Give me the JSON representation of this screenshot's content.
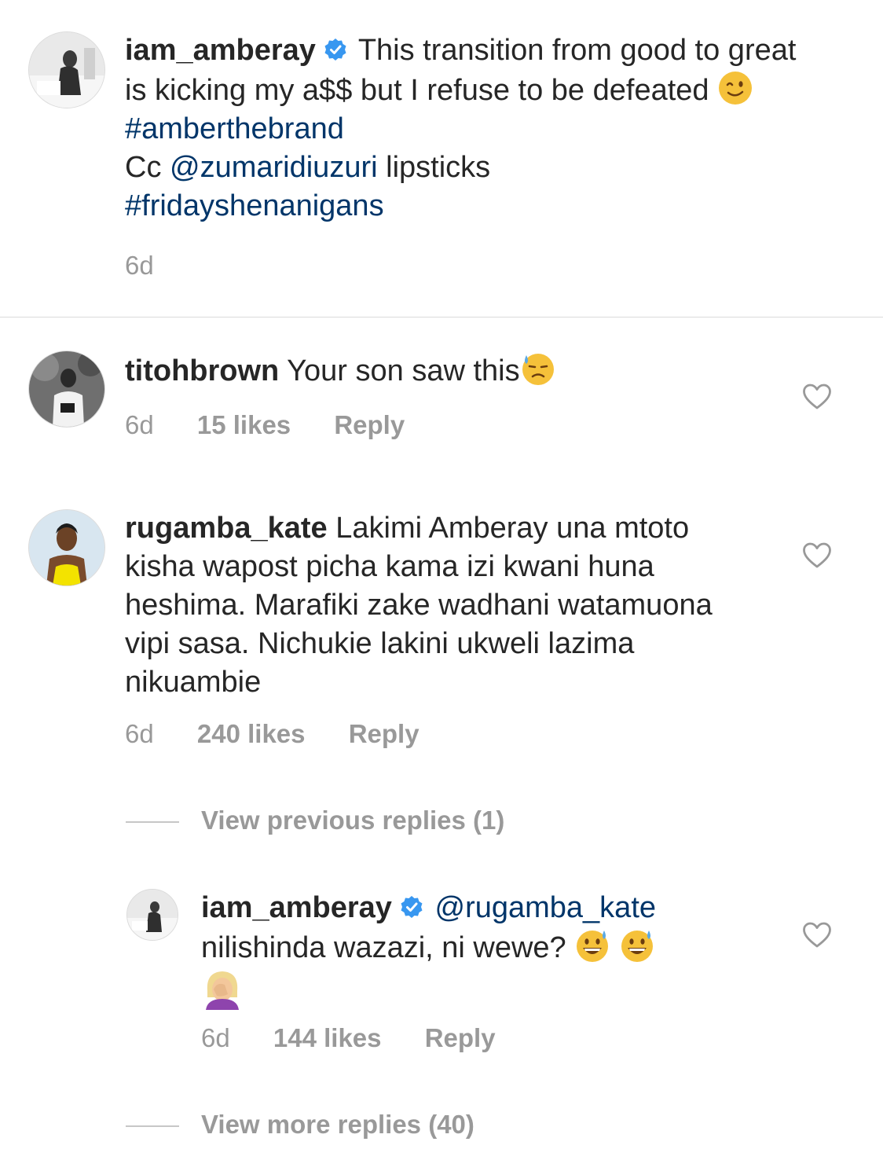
{
  "caption": {
    "username": "iam_amberay",
    "text_before_emoji": "This transition from good to great is kicking my a$$ but I refuse to be defeated",
    "hashtag1": "#amberthebrand",
    "cc_prefix": "Cc",
    "mention": "@zumaridiuzuri",
    "after_mention": "lipsticks",
    "hashtag2": "#fridayshenanigans",
    "time": "6d",
    "verified_icon": "verified-badge-icon",
    "emoji": "winking-face-emoji"
  },
  "comments": [
    {
      "username": "titohbrown",
      "text": "Your son saw this",
      "emoji": "downcast-face-with-sweat-emoji",
      "time": "6d",
      "likes": "15 likes",
      "reply": "Reply"
    },
    {
      "username": "rugamba_kate",
      "text": "Lakimi Amberay una mtoto kisha wapost picha kama izi kwani huna heshima. Marafiki zake wadhani watamuona vipi sasa. Nichukie lakini ukweli lazima nikuambie",
      "time": "6d",
      "likes": "240 likes",
      "reply": "Reply"
    }
  ],
  "view_previous": "View previous replies (1)",
  "reply": {
    "username": "iam_amberay",
    "mention": "@rugamba_kate",
    "text": "nilishinda wazazi, ni wewe?",
    "emojis": [
      "grinning-face-with-sweat-emoji",
      "grinning-face-with-sweat-emoji",
      "woman-facepalming-emoji"
    ],
    "time": "6d",
    "likes": "144 likes",
    "reply": "Reply"
  },
  "view_more": "View more replies (40)",
  "colors": {
    "text": "#262626",
    "link": "#003569",
    "meta": "#999999",
    "verified": "#3897f0",
    "divider": "#dbdbdb"
  }
}
